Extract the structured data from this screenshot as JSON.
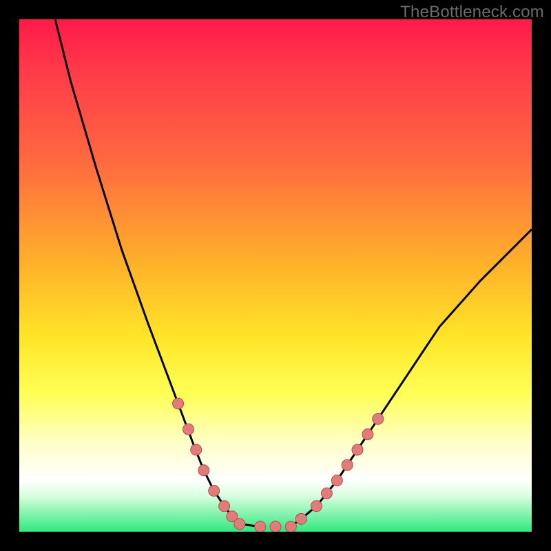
{
  "watermark": "TheBottleneck.com",
  "colors": {
    "background": "#000000",
    "gradient_top": "#ff1a4a",
    "gradient_mid": "#ffe528",
    "gradient_bottom": "#30e87c",
    "curve": "#000000",
    "marker_fill": "#e27b7b",
    "marker_stroke": "#b24e4e"
  },
  "chart_data": {
    "type": "line",
    "title": "",
    "xlabel": "",
    "ylabel": "",
    "xlim": [
      0,
      100
    ],
    "ylim": [
      0,
      100
    ],
    "annotations": [],
    "series": [
      {
        "name": "left-curve",
        "x": [
          7,
          10,
          15,
          20,
          25,
          28,
          31,
          34,
          36,
          38,
          40,
          41.5,
          43,
          47
        ],
        "y": [
          100,
          88,
          71,
          55,
          41,
          33,
          25,
          17,
          12,
          8,
          5,
          3,
          1.5,
          1
        ]
      },
      {
        "name": "right-curve",
        "x": [
          53,
          55,
          58,
          62,
          66,
          70,
          76,
          82,
          90,
          100
        ],
        "y": [
          1,
          2.5,
          5,
          10,
          16,
          22,
          31,
          40,
          49,
          59
        ]
      }
    ],
    "scatter": {
      "name": "markers",
      "points": [
        {
          "x": 31,
          "y": 25
        },
        {
          "x": 33,
          "y": 20
        },
        {
          "x": 34.5,
          "y": 16
        },
        {
          "x": 36,
          "y": 12
        },
        {
          "x": 38,
          "y": 8
        },
        {
          "x": 40,
          "y": 5
        },
        {
          "x": 41.5,
          "y": 3
        },
        {
          "x": 43,
          "y": 1.5
        },
        {
          "x": 47,
          "y": 1
        },
        {
          "x": 50,
          "y": 1
        },
        {
          "x": 53,
          "y": 1
        },
        {
          "x": 55,
          "y": 2.5
        },
        {
          "x": 58,
          "y": 5
        },
        {
          "x": 60,
          "y": 7.5
        },
        {
          "x": 62,
          "y": 10
        },
        {
          "x": 64,
          "y": 13
        },
        {
          "x": 66,
          "y": 16
        },
        {
          "x": 68,
          "y": 19
        },
        {
          "x": 70,
          "y": 22
        }
      ]
    }
  }
}
